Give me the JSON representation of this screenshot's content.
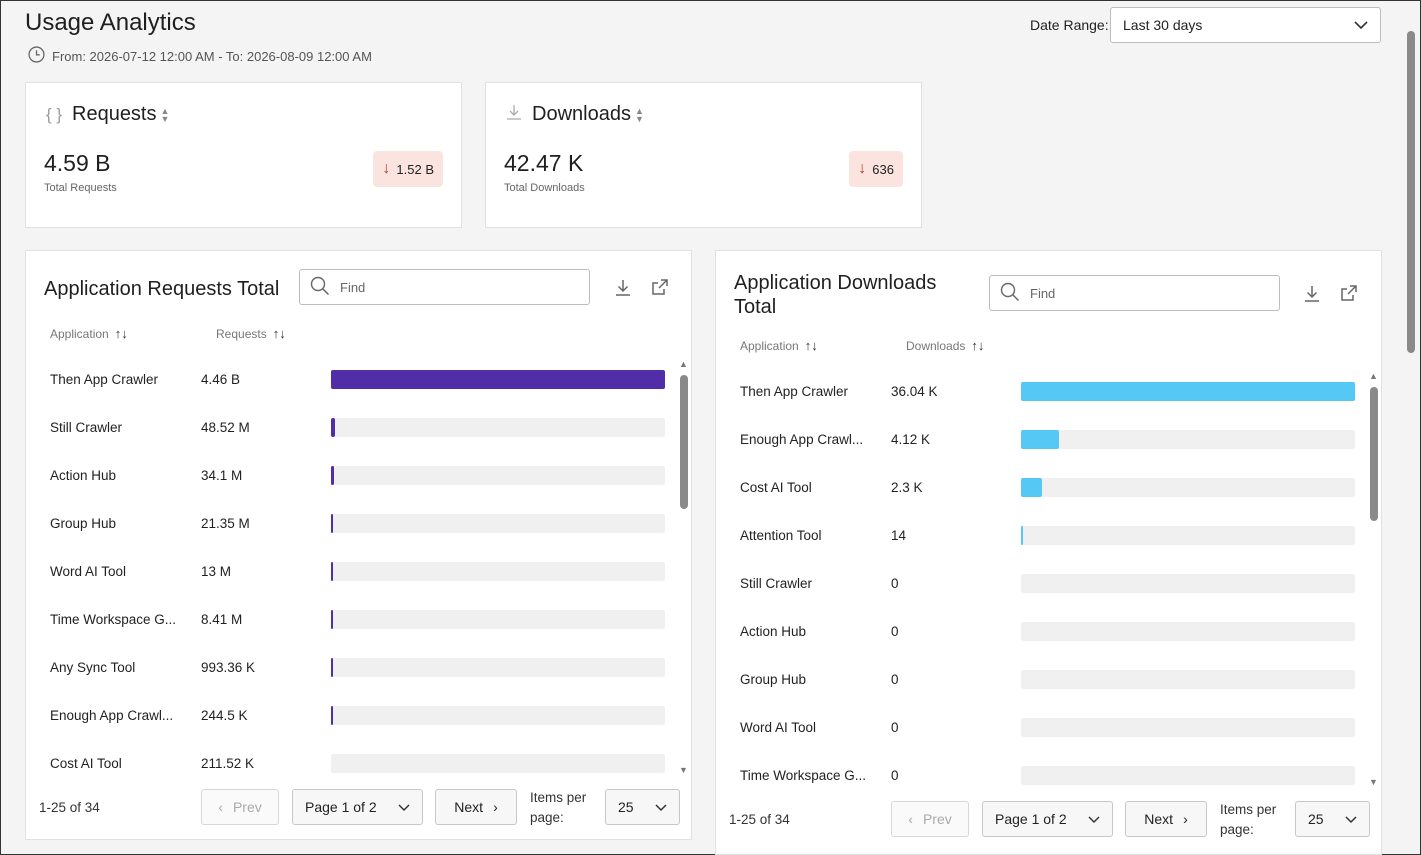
{
  "header": {
    "title": "Usage Analytics",
    "date_range_text": "From: 2026-07-12 12:00 AM - To: 2026-08-09 12:00 AM",
    "date_range_label": "Date Range:",
    "date_range_value": "Last 30 days"
  },
  "kpis": {
    "requests": {
      "title": "Requests",
      "value": "4.59 B",
      "subtitle": "Total Requests",
      "delta": "1.52 B",
      "delta_direction": "down"
    },
    "downloads": {
      "title": "Downloads",
      "value": "42.47 K",
      "subtitle": "Total Downloads",
      "delta": "636",
      "delta_direction": "down"
    }
  },
  "requests_table": {
    "title": "Application Requests Total",
    "find_placeholder": "Find",
    "col_app": "Application",
    "col_value": "Requests",
    "bar_color": "#512da8",
    "rows": [
      {
        "name": "Then App Crawler",
        "value": "4.46 B",
        "fraction": 1.0
      },
      {
        "name": "Still Crawler",
        "value": "48.52 M",
        "fraction": 0.0109
      },
      {
        "name": "Action Hub",
        "value": "34.1 M",
        "fraction": 0.0076
      },
      {
        "name": "Group Hub",
        "value": "21.35 M",
        "fraction": 0.0048
      },
      {
        "name": "Word AI Tool",
        "value": "13 M",
        "fraction": 0.0029
      },
      {
        "name": "Time Workspace G...",
        "value": "8.41 M",
        "fraction": 0.0019
      },
      {
        "name": "Any Sync Tool",
        "value": "993.36 K",
        "fraction": 0.0002
      },
      {
        "name": "Enough App Crawl...",
        "value": "244.5 K",
        "fraction": 0.0001
      },
      {
        "name": "Cost AI Tool",
        "value": "211.52 K",
        "fraction": 0.0
      }
    ],
    "range_text": "1-25 of 34",
    "prev_label": "Prev",
    "page_label": "Page 1 of 2",
    "next_label": "Next",
    "items_per_page_label": "Items per page:",
    "items_per_page": "25"
  },
  "downloads_table": {
    "title": "Application Downloads Total",
    "find_placeholder": "Find",
    "col_app": "Application",
    "col_value": "Downloads",
    "bar_color": "#56c8f5",
    "rows": [
      {
        "name": "Then App Crawler",
        "value": "36.04 K",
        "fraction": 1.0
      },
      {
        "name": "Enough App Crawl...",
        "value": "4.12 K",
        "fraction": 0.114
      },
      {
        "name": "Cost AI Tool",
        "value": "2.3 K",
        "fraction": 0.064
      },
      {
        "name": "Attention Tool",
        "value": "14",
        "fraction": 0.0004
      },
      {
        "name": "Still Crawler",
        "value": "0",
        "fraction": 0.0
      },
      {
        "name": "Action Hub",
        "value": "0",
        "fraction": 0.0
      },
      {
        "name": "Group Hub",
        "value": "0",
        "fraction": 0.0
      },
      {
        "name": "Word AI Tool",
        "value": "0",
        "fraction": 0.0
      },
      {
        "name": "Time Workspace G...",
        "value": "0",
        "fraction": 0.0
      }
    ],
    "range_text": "1-25 of 34",
    "prev_label": "Prev",
    "page_label": "Page 1 of 2",
    "next_label": "Next",
    "items_per_page_label": "Items per page:",
    "items_per_page": "25"
  }
}
